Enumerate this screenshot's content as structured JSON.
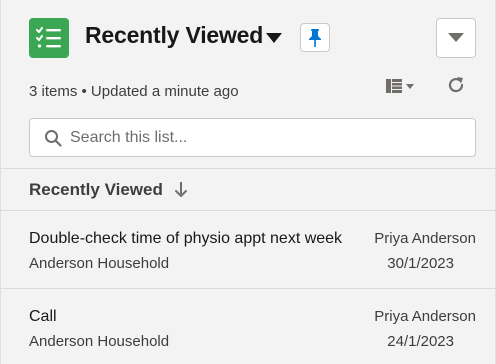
{
  "header": {
    "app_icon": "task-list-icon",
    "title": "Recently Viewed",
    "title_dropdown_icon": "caret-down-icon",
    "pin_icon": "pin-icon",
    "menu_icon": "chevron-down-icon"
  },
  "status": {
    "text": "3 items • Updated a minute ago"
  },
  "toolbar": {
    "display_as_icon": "table-icon",
    "refresh_icon": "refresh-icon"
  },
  "search": {
    "placeholder": "Search this list...",
    "value": ""
  },
  "list": {
    "sort_column": "Recently Viewed",
    "sort_icon": "arrow-down-icon",
    "items": [
      {
        "title": "Double-check time of physio appt next week",
        "related_to": "Anderson Household",
        "owner": "Priya Anderson",
        "date": "30/1/2023"
      },
      {
        "title": "Call",
        "related_to": "Anderson Household",
        "owner": "Priya Anderson",
        "date": "24/1/2023"
      }
    ]
  },
  "colors": {
    "app_icon_bg": "#3ba755",
    "pin_blue": "#0176d3",
    "background": "#f3f3f3"
  }
}
